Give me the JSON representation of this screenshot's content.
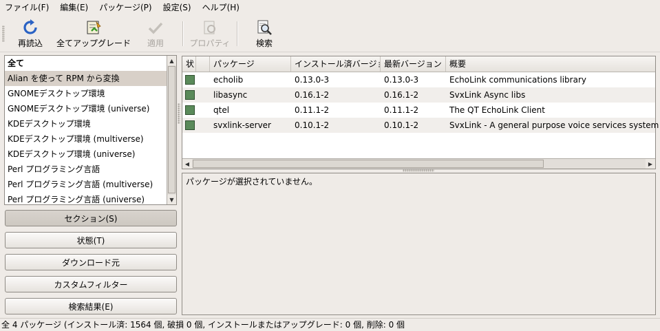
{
  "menu": [
    {
      "label": "ファイル(F)",
      "name": "menu-file"
    },
    {
      "label": "編集(E)",
      "name": "menu-edit"
    },
    {
      "label": "パッケージ(P)",
      "name": "menu-package"
    },
    {
      "label": "設定(S)",
      "name": "menu-settings"
    },
    {
      "label": "ヘルプ(H)",
      "name": "menu-help"
    }
  ],
  "toolbar": {
    "reload": {
      "label": "再読込",
      "icon": "reload-icon"
    },
    "upgrade_all": {
      "label": "全てアップグレード",
      "icon": "upgrade-icon"
    },
    "apply": {
      "label": "適用",
      "icon": "checkmark-icon",
      "disabled": true
    },
    "properties": {
      "label": "プロパティ",
      "icon": "properties-icon",
      "disabled": true
    },
    "search": {
      "label": "検索",
      "icon": "magnifier-icon"
    }
  },
  "sections": [
    {
      "label": "全て",
      "bold": true
    },
    {
      "label": "Alian を使って RPM から変換",
      "selected": true
    },
    {
      "label": "GNOMEデスクトップ環境"
    },
    {
      "label": "GNOMEデスクトップ環境 (universe)"
    },
    {
      "label": "KDEデスクトップ環境"
    },
    {
      "label": "KDEデスクトップ環境 (multiverse)"
    },
    {
      "label": "KDEデスクトップ環境 (universe)"
    },
    {
      "label": "Perl プログラミング言語"
    },
    {
      "label": "Perl プログラミング言語 (multiverse)"
    },
    {
      "label": "Perl プログラミング言語 (universe)"
    }
  ],
  "filter_buttons": {
    "section": "セクション(S)",
    "status": "状態(T)",
    "origin": "ダウンロード元",
    "custom": "カスタムフィルター",
    "search_results": "検索結果(E)"
  },
  "table": {
    "columns": {
      "status": "状",
      "package": "パッケージ",
      "installed": "インストール済バージョン",
      "latest": "最新バージョン",
      "summary": "概要"
    },
    "rows": [
      {
        "package": "echolib",
        "installed": "0.13.0-3",
        "latest": "0.13.0-3",
        "summary": "EchoLink communications library"
      },
      {
        "package": "libasync",
        "installed": "0.16.1-2",
        "latest": "0.16.1-2",
        "summary": "SvxLink Async libs"
      },
      {
        "package": "qtel",
        "installed": "0.11.1-2",
        "latest": "0.11.1-2",
        "summary": "The QT EchoLink Client"
      },
      {
        "package": "svxlink-server",
        "installed": "0.10.1-2",
        "latest": "0.10.1-2",
        "summary": "SvxLink - A general purpose voice services system"
      }
    ],
    "status_color": "#5a8a5a"
  },
  "description": "パッケージが選択されていません。",
  "statusbar": "全 4 パッケージ (インストール済: 1564 個, 破損 0 個, インストールまたはアップグレード: 0 個, 削除: 0 個"
}
